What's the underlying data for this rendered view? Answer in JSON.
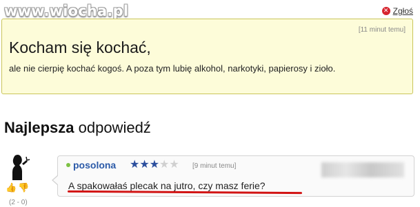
{
  "watermark": "www.wiocha.pl",
  "question": {
    "report_label": "Zgłoś",
    "time": "[11 minut temu]",
    "title": "Kocham się kochać,",
    "body": "ale nie cierpię kochać kogoś. A poza tym lubię alkohol, narkotyki, papierosy i zioło."
  },
  "best_answer": {
    "heading_bold": "Najlepsza",
    "heading_rest": " odpowiedź",
    "score": "(2 - 0)",
    "user": "posolona",
    "rating": {
      "filled": 3,
      "total": 5
    },
    "time": "[9 minut temu]",
    "text": "A spakowałaś plecak na jutro, czy masz ferie?"
  },
  "colors": {
    "question_bg": "#fdfcd9",
    "question_border": "#c9c55a",
    "username": "#2b5aa8",
    "underline": "#d21414"
  }
}
